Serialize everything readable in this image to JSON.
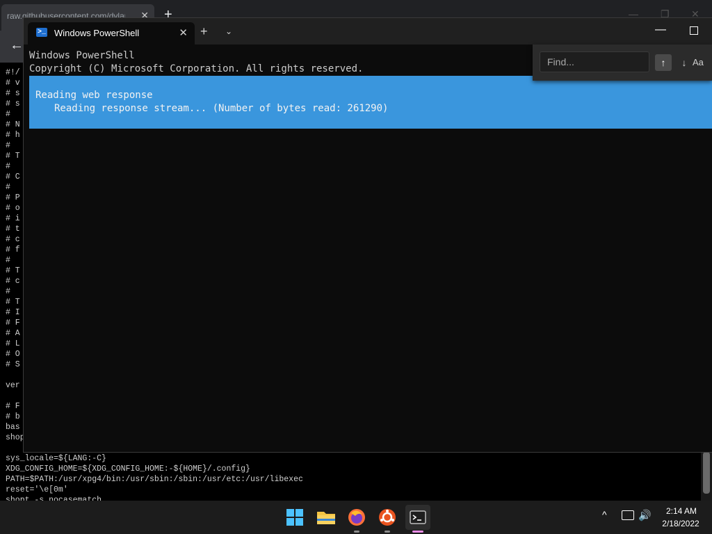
{
  "browser": {
    "tab_title": "raw.githubusercontent.com/dylana",
    "tab_close": "✕",
    "newtab_label": "+",
    "back_glyph": "←",
    "source_lines": [
      "#!/",
      "# v",
      "# s",
      "# s",
      "#",
      "# N",
      "# h",
      "#",
      "# T",
      "#",
      "# C",
      "#",
      "# P",
      "# o",
      "# i",
      "# t",
      "# c",
      "# f",
      "#",
      "# T",
      "# c",
      "#",
      "# T",
      "# I",
      "# F",
      "# A",
      "# L",
      "# O",
      "# S",
      "",
      "ver",
      "",
      "# F",
      "# b",
      "bas",
      "shop",
      "",
      "sys_locale=${LANG:-C}",
      "XDG_CONFIG_HOME=${XDG_CONFIG_HOME:-${HOME}/.config}",
      "PATH=$PATH:/usr/xpg4/bin:/usr/sbin:/sbin:/usr/etc:/usr/libexec",
      "reset='\\e[0m'",
      "shopt -s nocasematch"
    ]
  },
  "terminal": {
    "tab_title": "Windows PowerShell",
    "tab_close": "✕",
    "newtab_label": "+",
    "dropdown_glyph": "⌄",
    "minimize_glyph": "—",
    "header_line1": "Windows PowerShell",
    "header_line2": "Copyright (C) Microsoft Corporation. All rights reserved.",
    "progress": {
      "activity": "Reading web response",
      "status": "Reading response stream... (Number of bytes read: 261290)",
      "color": "#3a96dd"
    }
  },
  "find": {
    "placeholder": "Find...",
    "up_glyph": "↑",
    "down_glyph": "↓",
    "case_label": "Aa"
  },
  "taskbar": {
    "apps": [
      "start-menu",
      "file-explorer",
      "firefox",
      "ubuntu",
      "windows-terminal"
    ],
    "tray_chevron": "^",
    "volume_glyph": "🔊",
    "time": "2:14 AM",
    "date": "2/18/2022"
  }
}
